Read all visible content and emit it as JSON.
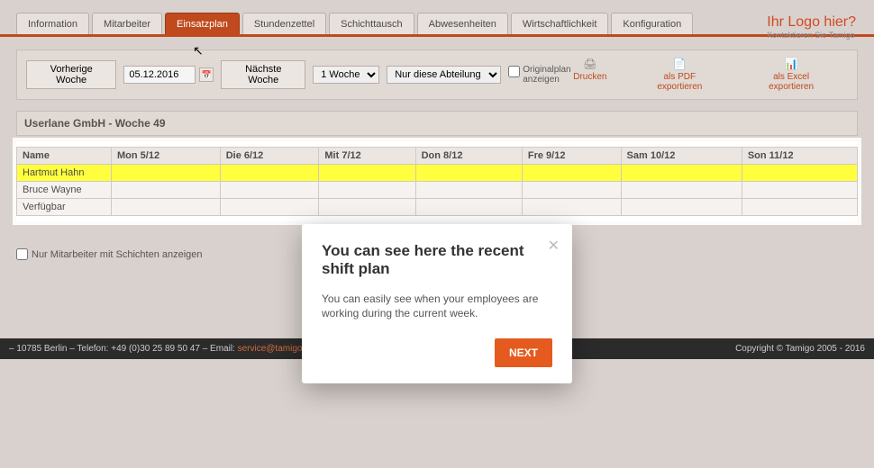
{
  "logo": {
    "title": "Ihr Logo hier?",
    "subtitle": "Kontaktieren Sie Tamigo"
  },
  "tabs": [
    {
      "label": "Information",
      "active": false
    },
    {
      "label": "Mitarbeiter",
      "active": false
    },
    {
      "label": "Einsatzplan",
      "active": true
    },
    {
      "label": "Stundenzettel",
      "active": false
    },
    {
      "label": "Schichttausch",
      "active": false
    },
    {
      "label": "Abwesenheiten",
      "active": false
    },
    {
      "label": "Wirtschaftlichkeit",
      "active": false
    },
    {
      "label": "Konfiguration",
      "active": false
    }
  ],
  "toolbar": {
    "prev_week": "Vorherige Woche",
    "date_value": "05.12.2016",
    "next_week": "Nächste Woche",
    "duration_selected": "1 Woche",
    "dept_selected": "Nur diese Abteilung",
    "original_plan_label": "Originalplan anzeigen"
  },
  "exports": {
    "print": "Drucken",
    "pdf": "als PDF exportieren",
    "excel": "als Excel exportieren"
  },
  "section_title": "Userlane GmbH - Woche 49",
  "table": {
    "headers": [
      "Name",
      "Mon 5/12",
      "Die 6/12",
      "Mit 7/12",
      "Don 8/12",
      "Fre 9/12",
      "Sam 10/12",
      "Son 11/12"
    ],
    "rows": [
      {
        "name": "Hartmut Hahn",
        "highlight": true,
        "cells": [
          "",
          "",
          "",
          "",
          "",
          "",
          ""
        ]
      },
      {
        "name": "Bruce Wayne",
        "highlight": false,
        "cells": [
          "",
          "",
          "",
          "",
          "",
          "",
          ""
        ]
      },
      {
        "name": "Verfügbar",
        "highlight": false,
        "cells": [
          "",
          "",
          "",
          "",
          "",
          "",
          ""
        ]
      }
    ]
  },
  "filter_checkbox_label": "Nur Mitarbeiter mit Schichten anzeigen",
  "footer": {
    "left_prefix": "– 10785 Berlin – Telefon: +49 (0)30 25 89 50 47 – Email: ",
    "email": "service@tamigo.de",
    "right": "Copyright © Tamigo 2005 - 2016"
  },
  "modal": {
    "title": "You can see here the recent shift plan",
    "body": "You can easily see when your employees are working during the current week.",
    "next": "NEXT"
  }
}
